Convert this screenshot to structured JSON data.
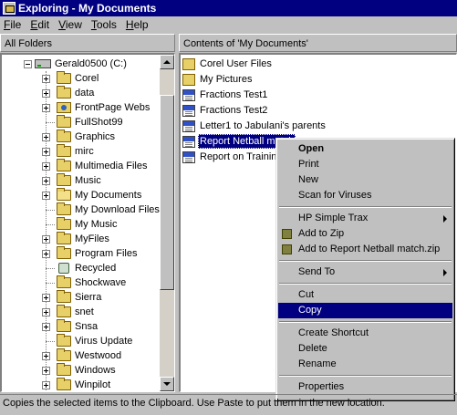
{
  "window": {
    "title": "Exploring - My Documents"
  },
  "menubar": [
    {
      "label": "File",
      "accel": "F",
      "rest": "ile"
    },
    {
      "label": "Edit",
      "accel": "E",
      "rest": "dit"
    },
    {
      "label": "View",
      "accel": "V",
      "rest": "iew"
    },
    {
      "label": "Tools",
      "accel": "T",
      "rest": "ools"
    },
    {
      "label": "Help",
      "accel": "H",
      "rest": "elp"
    }
  ],
  "left_header": "All Folders",
  "right_header": "Contents of 'My Documents'",
  "tree": {
    "drive_label": "Gerald0500 (C:)",
    "folders": [
      {
        "label": "Corel",
        "expandable": true,
        "icon": "folder-icon"
      },
      {
        "label": "data",
        "expandable": true,
        "icon": "folder-icon"
      },
      {
        "label": "FrontPage Webs",
        "expandable": true,
        "icon": "web-folder-icon"
      },
      {
        "label": "FullShot99",
        "expandable": false,
        "icon": "folder-icon"
      },
      {
        "label": "Graphics",
        "expandable": true,
        "icon": "folder-icon"
      },
      {
        "label": "mirc",
        "expandable": true,
        "icon": "folder-icon"
      },
      {
        "label": "Multimedia Files",
        "expandable": true,
        "icon": "folder-icon"
      },
      {
        "label": "Music",
        "expandable": true,
        "icon": "folder-icon"
      },
      {
        "label": "My Documents",
        "expandable": true,
        "icon": "open-folder-icon"
      },
      {
        "label": "My Download Files",
        "expandable": false,
        "icon": "folder-icon"
      },
      {
        "label": "My Music",
        "expandable": false,
        "icon": "folder-icon"
      },
      {
        "label": "MyFiles",
        "expandable": true,
        "icon": "folder-icon"
      },
      {
        "label": "Program Files",
        "expandable": true,
        "icon": "folder-icon"
      },
      {
        "label": "Recycled",
        "expandable": false,
        "icon": "recycle-bin-icon"
      },
      {
        "label": "Shockwave",
        "expandable": false,
        "icon": "folder-icon"
      },
      {
        "label": "Sierra",
        "expandable": true,
        "icon": "folder-icon"
      },
      {
        "label": "snet",
        "expandable": true,
        "icon": "folder-icon"
      },
      {
        "label": "Snsa",
        "expandable": true,
        "icon": "folder-icon"
      },
      {
        "label": "Virus Update",
        "expandable": false,
        "icon": "folder-icon"
      },
      {
        "label": "Westwood",
        "expandable": true,
        "icon": "folder-icon"
      },
      {
        "label": "Windows",
        "expandable": true,
        "icon": "folder-icon"
      },
      {
        "label": "Winpilot",
        "expandable": true,
        "icon": "folder-icon"
      }
    ]
  },
  "contents": [
    {
      "label": "Corel User Files",
      "type": "folder",
      "selected": false
    },
    {
      "label": "My Pictures",
      "type": "folder",
      "selected": false
    },
    {
      "label": "Fractions Test1",
      "type": "doc",
      "selected": false
    },
    {
      "label": "Fractions Test2",
      "type": "doc",
      "selected": false
    },
    {
      "label": "Letter1 to Jabulani's parents",
      "type": "doc",
      "selected": false
    },
    {
      "label": "Report Netball match",
      "type": "doc",
      "selected": true
    },
    {
      "label": "Report on Training",
      "type": "doc",
      "selected": false
    }
  ],
  "context_menu": {
    "items": [
      {
        "label": "Open",
        "bold": true,
        "name": "open-menu-item"
      },
      {
        "label": "Print",
        "name": "print-menu-item"
      },
      {
        "label": "New",
        "name": "new-menu-item"
      },
      {
        "label": "Scan for Viruses",
        "name": "scan-for-viruses-menu-item"
      },
      {
        "sep": true
      },
      {
        "label": "HP Simple Trax",
        "submenu": true,
        "name": "hp-simple-trax-menu-item"
      },
      {
        "label": "Add to Zip",
        "icon": "zip-icon",
        "name": "add-to-zip-menu-item"
      },
      {
        "label": "Add to Report Netball match.zip",
        "icon": "zip-icon",
        "name": "add-to-named-zip-menu-item"
      },
      {
        "sep": true
      },
      {
        "label": "Send To",
        "submenu": true,
        "name": "send-to-menu-item"
      },
      {
        "sep": true
      },
      {
        "label": "Cut",
        "name": "cut-menu-item"
      },
      {
        "label": "Copy",
        "highlighted": true,
        "name": "copy-menu-item"
      },
      {
        "sep": true
      },
      {
        "label": "Create Shortcut",
        "name": "create-shortcut-menu-item"
      },
      {
        "label": "Delete",
        "name": "delete-menu-item"
      },
      {
        "label": "Rename",
        "name": "rename-menu-item"
      },
      {
        "sep": true
      },
      {
        "label": "Properties",
        "name": "properties-menu-item"
      }
    ]
  },
  "statusbar": "Copies the selected items to the Clipboard. Use Paste to put them in the new location."
}
